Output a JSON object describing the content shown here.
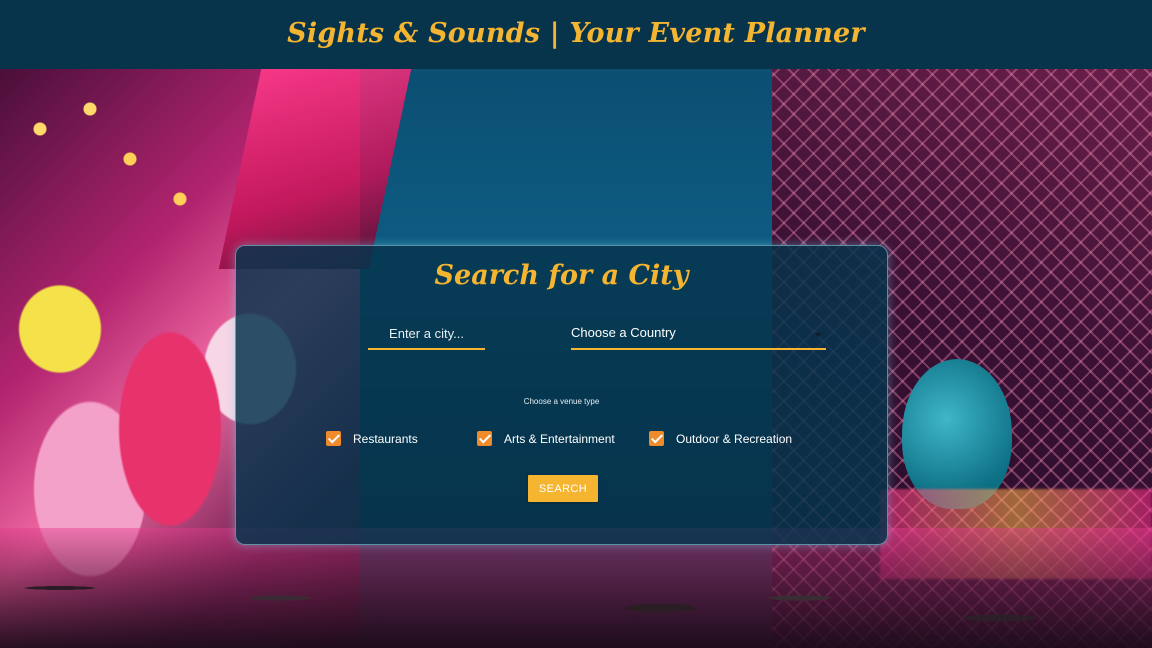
{
  "header": {
    "title": "Sights & Sounds | Your Event Planner"
  },
  "search_panel": {
    "title": "Search for a City",
    "city_input": {
      "placeholder": "Enter a city...",
      "value": ""
    },
    "country_select": {
      "selected": "Choose a Country"
    },
    "venue_caption": "Choose a venue type",
    "venue_types": [
      {
        "label": "Restaurants",
        "checked": true
      },
      {
        "label": "Arts & Entertainment",
        "checked": true
      },
      {
        "label": "Outdoor & Recreation",
        "checked": true
      }
    ],
    "search_button": "SEARCH"
  },
  "colors": {
    "header_bg": "#07344b",
    "accent": "#f5b531",
    "checkbox": "#f08b2c",
    "panel_bg": "#06344c"
  },
  "background": {
    "icon": "carnival-night-photo"
  }
}
